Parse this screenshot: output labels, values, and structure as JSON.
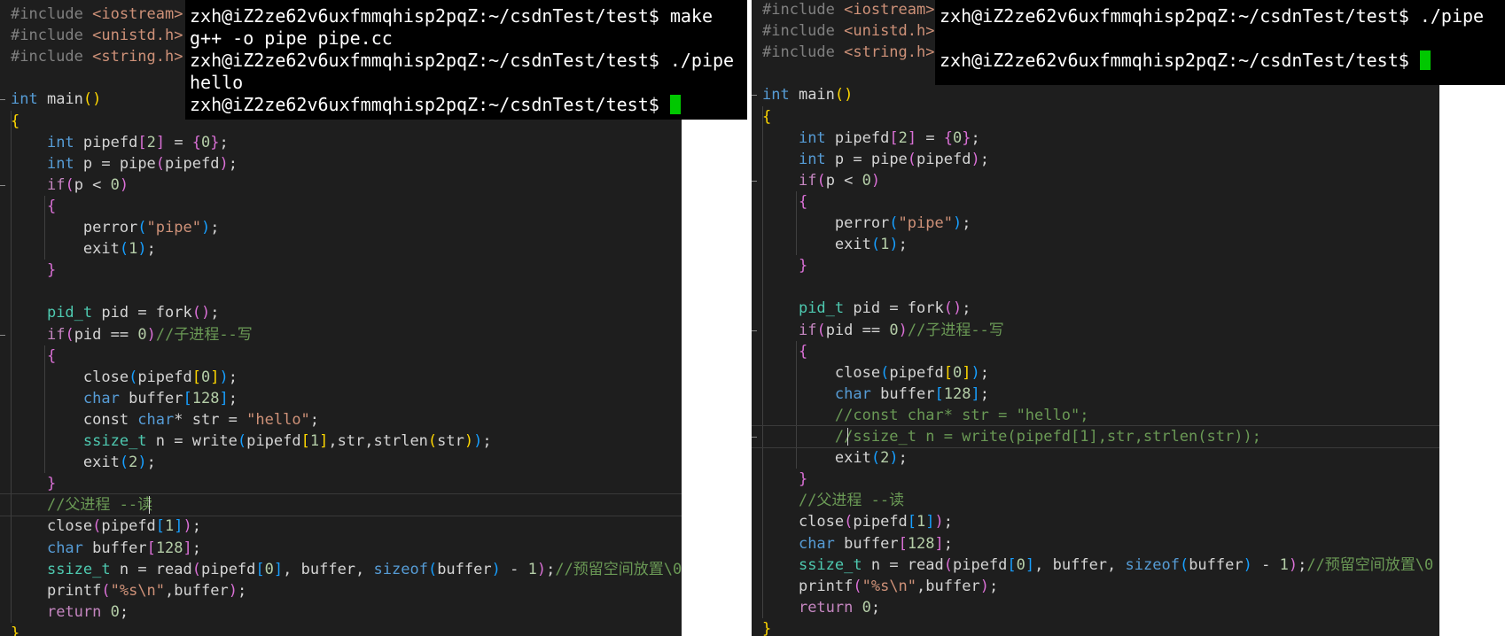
{
  "left": {
    "terminal": {
      "prompt": "zxh@iZ2ze62v6uxfmmqhisp2pqZ:~/csdnTest/test$",
      "lines": [
        {
          "cmd": "make"
        },
        {
          "text": "g++ -o pipe pipe.cc"
        },
        {
          "cmd": "./pipe"
        },
        {
          "text": "hello"
        },
        {
          "cmd": "",
          "cursor": true
        }
      ]
    },
    "code": [
      [
        [
          "#include ",
          "p"
        ],
        [
          "<iostream>",
          "s"
        ]
      ],
      [
        [
          "#include ",
          "p"
        ],
        [
          "<unistd.h>",
          "s"
        ]
      ],
      [
        [
          "#include ",
          "p"
        ],
        [
          "<string.h>",
          "s"
        ]
      ],
      [],
      [
        [
          "int",
          "k"
        ],
        [
          " main",
          ""
        ],
        [
          "()",
          "b1"
        ]
      ],
      [
        [
          "{",
          "b1"
        ]
      ],
      [
        [
          "    ",
          ""
        ],
        [
          "int",
          "k"
        ],
        [
          " pipefd",
          ""
        ],
        [
          "[",
          "b2"
        ],
        [
          "2",
          "n"
        ],
        [
          "]",
          "b2"
        ],
        [
          " = ",
          ""
        ],
        [
          "{",
          "b2"
        ],
        [
          "0",
          "n"
        ],
        [
          "}",
          "b2"
        ],
        [
          ";",
          ""
        ]
      ],
      [
        [
          "    ",
          ""
        ],
        [
          "int",
          "k"
        ],
        [
          " p = pipe",
          ""
        ],
        [
          "(",
          "b2"
        ],
        [
          "pipefd",
          ""
        ],
        [
          ")",
          "b2"
        ],
        [
          ";",
          ""
        ]
      ],
      [
        [
          "    ",
          ""
        ],
        [
          "if",
          "c"
        ],
        [
          "(",
          "b2"
        ],
        [
          "p < ",
          ""
        ],
        [
          "0",
          "n"
        ],
        [
          ")",
          "b2"
        ]
      ],
      [
        [
          "    ",
          ""
        ],
        [
          "{",
          "b2"
        ]
      ],
      [
        [
          "        perror",
          ""
        ],
        [
          "(",
          "b3"
        ],
        [
          "\"pipe\"",
          "s"
        ],
        [
          ")",
          "b3"
        ],
        [
          ";",
          ""
        ]
      ],
      [
        [
          "        exit",
          ""
        ],
        [
          "(",
          "b3"
        ],
        [
          "1",
          "n"
        ],
        [
          ")",
          "b3"
        ],
        [
          ";",
          ""
        ]
      ],
      [
        [
          "    ",
          ""
        ],
        [
          "}",
          "b2"
        ]
      ],
      [],
      [
        [
          "    ",
          ""
        ],
        [
          "pid_t",
          "t"
        ],
        [
          " pid = fork",
          ""
        ],
        [
          "()",
          "b2"
        ],
        [
          ";",
          ""
        ]
      ],
      [
        [
          "    ",
          ""
        ],
        [
          "if",
          "c"
        ],
        [
          "(",
          "b2"
        ],
        [
          "pid == ",
          ""
        ],
        [
          "0",
          "n"
        ],
        [
          ")",
          "b2"
        ],
        [
          "//子进程--写",
          "m"
        ]
      ],
      [
        [
          "    ",
          ""
        ],
        [
          "{",
          "b2"
        ]
      ],
      [
        [
          "        close",
          ""
        ],
        [
          "(",
          "b3"
        ],
        [
          "pipefd",
          ""
        ],
        [
          "[",
          "b1"
        ],
        [
          "0",
          "n"
        ],
        [
          "]",
          "b1"
        ],
        [
          ")",
          "b3"
        ],
        [
          ";",
          ""
        ]
      ],
      [
        [
          "        ",
          ""
        ],
        [
          "char",
          "k"
        ],
        [
          " buffer",
          ""
        ],
        [
          "[",
          "b3"
        ],
        [
          "128",
          "n"
        ],
        [
          "]",
          "b3"
        ],
        [
          ";",
          ""
        ]
      ],
      [
        [
          "        const ",
          ""
        ],
        [
          "char",
          "k"
        ],
        [
          "* str = ",
          ""
        ],
        [
          "\"hello\"",
          "s"
        ],
        [
          ";",
          ""
        ]
      ],
      [
        [
          "        ",
          ""
        ],
        [
          "ssize_t",
          "t"
        ],
        [
          " n = write",
          ""
        ],
        [
          "(",
          "b3"
        ],
        [
          "pipefd",
          ""
        ],
        [
          "[",
          "b1"
        ],
        [
          "1",
          "n"
        ],
        [
          "]",
          "b1"
        ],
        [
          ",str,strlen",
          ""
        ],
        [
          "(",
          "b1"
        ],
        [
          "str",
          ""
        ],
        [
          ")",
          "b1"
        ],
        [
          ")",
          "b3"
        ],
        [
          ";",
          ""
        ]
      ],
      [
        [
          "        exit",
          ""
        ],
        [
          "(",
          "b3"
        ],
        [
          "2",
          "n"
        ],
        [
          ")",
          "b3"
        ],
        [
          ";",
          ""
        ]
      ],
      [
        [
          "    ",
          ""
        ],
        [
          "}",
          "b2"
        ]
      ],
      [
        [
          "    ",
          ""
        ],
        [
          "//父进程 --读",
          "m"
        ]
      ],
      [
        [
          "    close",
          ""
        ],
        [
          "(",
          "b2"
        ],
        [
          "pipefd",
          ""
        ],
        [
          "[",
          "b3"
        ],
        [
          "1",
          "n"
        ],
        [
          "]",
          "b3"
        ],
        [
          ")",
          "b2"
        ],
        [
          ";",
          ""
        ]
      ],
      [
        [
          "    ",
          ""
        ],
        [
          "char",
          "k"
        ],
        [
          " buffer",
          ""
        ],
        [
          "[",
          "b2"
        ],
        [
          "128",
          "n"
        ],
        [
          "]",
          "b2"
        ],
        [
          ";",
          ""
        ]
      ],
      [
        [
          "    ",
          ""
        ],
        [
          "ssize_t",
          "t"
        ],
        [
          " n = read",
          ""
        ],
        [
          "(",
          "b2"
        ],
        [
          "pipefd",
          ""
        ],
        [
          "[",
          "b3"
        ],
        [
          "0",
          "n"
        ],
        [
          "]",
          "b3"
        ],
        [
          ", buffer, ",
          ""
        ],
        [
          "sizeof",
          "k"
        ],
        [
          "(",
          "b3"
        ],
        [
          "buffer",
          ""
        ],
        [
          ")",
          "b3"
        ],
        [
          " - ",
          ""
        ],
        [
          "1",
          "n"
        ],
        [
          ")",
          "b2"
        ],
        [
          ";",
          ""
        ],
        [
          "//预留空间放置\\0",
          "m"
        ]
      ],
      [
        [
          "    printf",
          ""
        ],
        [
          "(",
          "b2"
        ],
        [
          "\"%s\\n\"",
          "s"
        ],
        [
          ",buffer",
          ""
        ],
        [
          ")",
          "b2"
        ],
        [
          ";",
          ""
        ]
      ],
      [
        [
          "    ",
          ""
        ],
        [
          "return",
          "c"
        ],
        [
          " ",
          ""
        ],
        [
          "0",
          "n"
        ],
        [
          ";",
          ""
        ]
      ],
      [
        [
          "}",
          "b1"
        ]
      ]
    ]
  },
  "right": {
    "terminal": {
      "prompt": "zxh@iZ2ze62v6uxfmmqhisp2pqZ:~/csdnTest/test$",
      "lines": [
        {
          "cmd": "./pipe"
        },
        {
          "text": ""
        },
        {
          "cmd": "",
          "cursor": true
        }
      ]
    },
    "code": [
      [
        [
          "#include ",
          "p"
        ],
        [
          "<iostream>",
          "s"
        ]
      ],
      [
        [
          "#include ",
          "p"
        ],
        [
          "<unistd.h>",
          "s"
        ]
      ],
      [
        [
          "#include ",
          "p"
        ],
        [
          "<string.h>",
          "s"
        ]
      ],
      [],
      [
        [
          "int",
          "k"
        ],
        [
          " main",
          ""
        ],
        [
          "()",
          "b1"
        ]
      ],
      [
        [
          "{",
          "b1"
        ]
      ],
      [
        [
          "    ",
          ""
        ],
        [
          "int",
          "k"
        ],
        [
          " pipefd",
          ""
        ],
        [
          "[",
          "b2"
        ],
        [
          "2",
          "n"
        ],
        [
          "]",
          "b2"
        ],
        [
          " = ",
          ""
        ],
        [
          "{",
          "b2"
        ],
        [
          "0",
          "n"
        ],
        [
          "}",
          "b2"
        ],
        [
          ";",
          ""
        ]
      ],
      [
        [
          "    ",
          ""
        ],
        [
          "int",
          "k"
        ],
        [
          " p = pipe",
          ""
        ],
        [
          "(",
          "b2"
        ],
        [
          "pipefd",
          ""
        ],
        [
          ")",
          "b2"
        ],
        [
          ";",
          ""
        ]
      ],
      [
        [
          "    ",
          ""
        ],
        [
          "if",
          "c"
        ],
        [
          "(",
          "b2"
        ],
        [
          "p < ",
          ""
        ],
        [
          "0",
          "n"
        ],
        [
          ")",
          "b2"
        ]
      ],
      [
        [
          "    ",
          ""
        ],
        [
          "{",
          "b2"
        ]
      ],
      [
        [
          "        perror",
          ""
        ],
        [
          "(",
          "b3"
        ],
        [
          "\"pipe\"",
          "s"
        ],
        [
          ")",
          "b3"
        ],
        [
          ";",
          ""
        ]
      ],
      [
        [
          "        exit",
          ""
        ],
        [
          "(",
          "b3"
        ],
        [
          "1",
          "n"
        ],
        [
          ")",
          "b3"
        ],
        [
          ";",
          ""
        ]
      ],
      [
        [
          "    ",
          ""
        ],
        [
          "}",
          "b2"
        ]
      ],
      [],
      [
        [
          "    ",
          ""
        ],
        [
          "pid_t",
          "t"
        ],
        [
          " pid = fork",
          ""
        ],
        [
          "()",
          "b2"
        ],
        [
          ";",
          ""
        ]
      ],
      [
        [
          "    ",
          ""
        ],
        [
          "if",
          "c"
        ],
        [
          "(",
          "b2"
        ],
        [
          "pid == ",
          ""
        ],
        [
          "0",
          "n"
        ],
        [
          ")",
          "b2"
        ],
        [
          "//子进程--写",
          "m"
        ]
      ],
      [
        [
          "    ",
          ""
        ],
        [
          "{",
          "b2"
        ]
      ],
      [
        [
          "        close",
          ""
        ],
        [
          "(",
          "b3"
        ],
        [
          "pipefd",
          ""
        ],
        [
          "[",
          "b1"
        ],
        [
          "0",
          "n"
        ],
        [
          "]",
          "b1"
        ],
        [
          ")",
          "b3"
        ],
        [
          ";",
          ""
        ]
      ],
      [
        [
          "        ",
          ""
        ],
        [
          "char",
          "k"
        ],
        [
          " buffer",
          ""
        ],
        [
          "[",
          "b3"
        ],
        [
          "128",
          "n"
        ],
        [
          "]",
          "b3"
        ],
        [
          ";",
          ""
        ]
      ],
      [
        [
          "        //const char* str = \"hello\";",
          "m"
        ]
      ],
      [
        [
          "        //ssize_t n = write(pipefd[1],str,strlen(str));",
          "m"
        ]
      ],
      [
        [
          "        exit",
          ""
        ],
        [
          "(",
          "b3"
        ],
        [
          "2",
          "n"
        ],
        [
          ")",
          "b3"
        ],
        [
          ";",
          ""
        ]
      ],
      [
        [
          "    ",
          ""
        ],
        [
          "}",
          "b2"
        ]
      ],
      [
        [
          "    ",
          ""
        ],
        [
          "//父进程 --读",
          "m"
        ]
      ],
      [
        [
          "    close",
          ""
        ],
        [
          "(",
          "b2"
        ],
        [
          "pipefd",
          ""
        ],
        [
          "[",
          "b3"
        ],
        [
          "1",
          "n"
        ],
        [
          "]",
          "b3"
        ],
        [
          ")",
          "b2"
        ],
        [
          ";",
          ""
        ]
      ],
      [
        [
          "    ",
          ""
        ],
        [
          "char",
          "k"
        ],
        [
          " buffer",
          ""
        ],
        [
          "[",
          "b2"
        ],
        [
          "128",
          "n"
        ],
        [
          "]",
          "b2"
        ],
        [
          ";",
          ""
        ]
      ],
      [
        [
          "    ",
          ""
        ],
        [
          "ssize_t",
          "t"
        ],
        [
          " n = read",
          ""
        ],
        [
          "(",
          "b2"
        ],
        [
          "pipefd",
          ""
        ],
        [
          "[",
          "b3"
        ],
        [
          "0",
          "n"
        ],
        [
          "]",
          "b3"
        ],
        [
          ", buffer, ",
          ""
        ],
        [
          "sizeof",
          "k"
        ],
        [
          "(",
          "b3"
        ],
        [
          "buffer",
          ""
        ],
        [
          ")",
          "b3"
        ],
        [
          " - ",
          ""
        ],
        [
          "1",
          "n"
        ],
        [
          ")",
          "b2"
        ],
        [
          ";",
          ""
        ],
        [
          "//预留空间放置\\0",
          "m"
        ]
      ],
      [
        [
          "    printf",
          ""
        ],
        [
          "(",
          "b2"
        ],
        [
          "\"%s\\n\"",
          "s"
        ],
        [
          ",buffer",
          ""
        ],
        [
          ")",
          "b2"
        ],
        [
          ";",
          ""
        ]
      ],
      [
        [
          "    ",
          ""
        ],
        [
          "return",
          "c"
        ],
        [
          " ",
          ""
        ],
        [
          "0",
          "n"
        ],
        [
          ";",
          ""
        ]
      ],
      [
        [
          "}",
          "b1"
        ]
      ]
    ]
  }
}
